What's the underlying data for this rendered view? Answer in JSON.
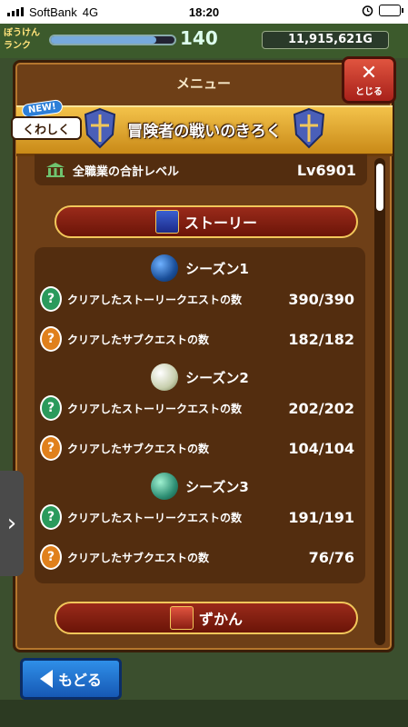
{
  "status_bar": {
    "carrier": "SoftBank",
    "network": "4G",
    "time": "18:20"
  },
  "hud": {
    "rank_label": "ぼうけん\nランク",
    "rank_value": "140",
    "rank_progress": 0.85,
    "gold": "11,915,621G"
  },
  "header": {
    "menu_title": "メニュー",
    "close_label": "とじる",
    "new_badge": "NEW!",
    "details_button": "くわしく",
    "record_title": "冒険者の戦いのきろく"
  },
  "total_level": {
    "label": "全職業の合計レベル",
    "value": "Lv6901"
  },
  "story_section": {
    "label": "ストーリー",
    "seasons": [
      {
        "name": "シーズン1",
        "stats": [
          {
            "label": "クリアしたストーリークエストの数",
            "value": "390/390",
            "icon": "green"
          },
          {
            "label": "クリアしたサブクエストの数",
            "value": "182/182",
            "icon": "orange"
          }
        ]
      },
      {
        "name": "シーズン2",
        "stats": [
          {
            "label": "クリアしたストーリークエストの数",
            "value": "202/202",
            "icon": "green"
          },
          {
            "label": "クリアしたサブクエストの数",
            "value": "104/104",
            "icon": "orange"
          }
        ]
      },
      {
        "name": "シーズン3",
        "stats": [
          {
            "label": "クリアしたストーリークエストの数",
            "value": "191/191",
            "icon": "green"
          },
          {
            "label": "クリアしたサブクエストの数",
            "value": "76/76",
            "icon": "orange"
          }
        ]
      }
    ]
  },
  "encyclopedia_section": {
    "label": "ずかん"
  },
  "back_button": "もどる",
  "colors": {
    "panel": "#6e3f17",
    "row_bg": "#532d0f",
    "section_red": "#9a2a1a",
    "gold_border": "#f2c75a",
    "back_blue": "#2f8fe8"
  }
}
